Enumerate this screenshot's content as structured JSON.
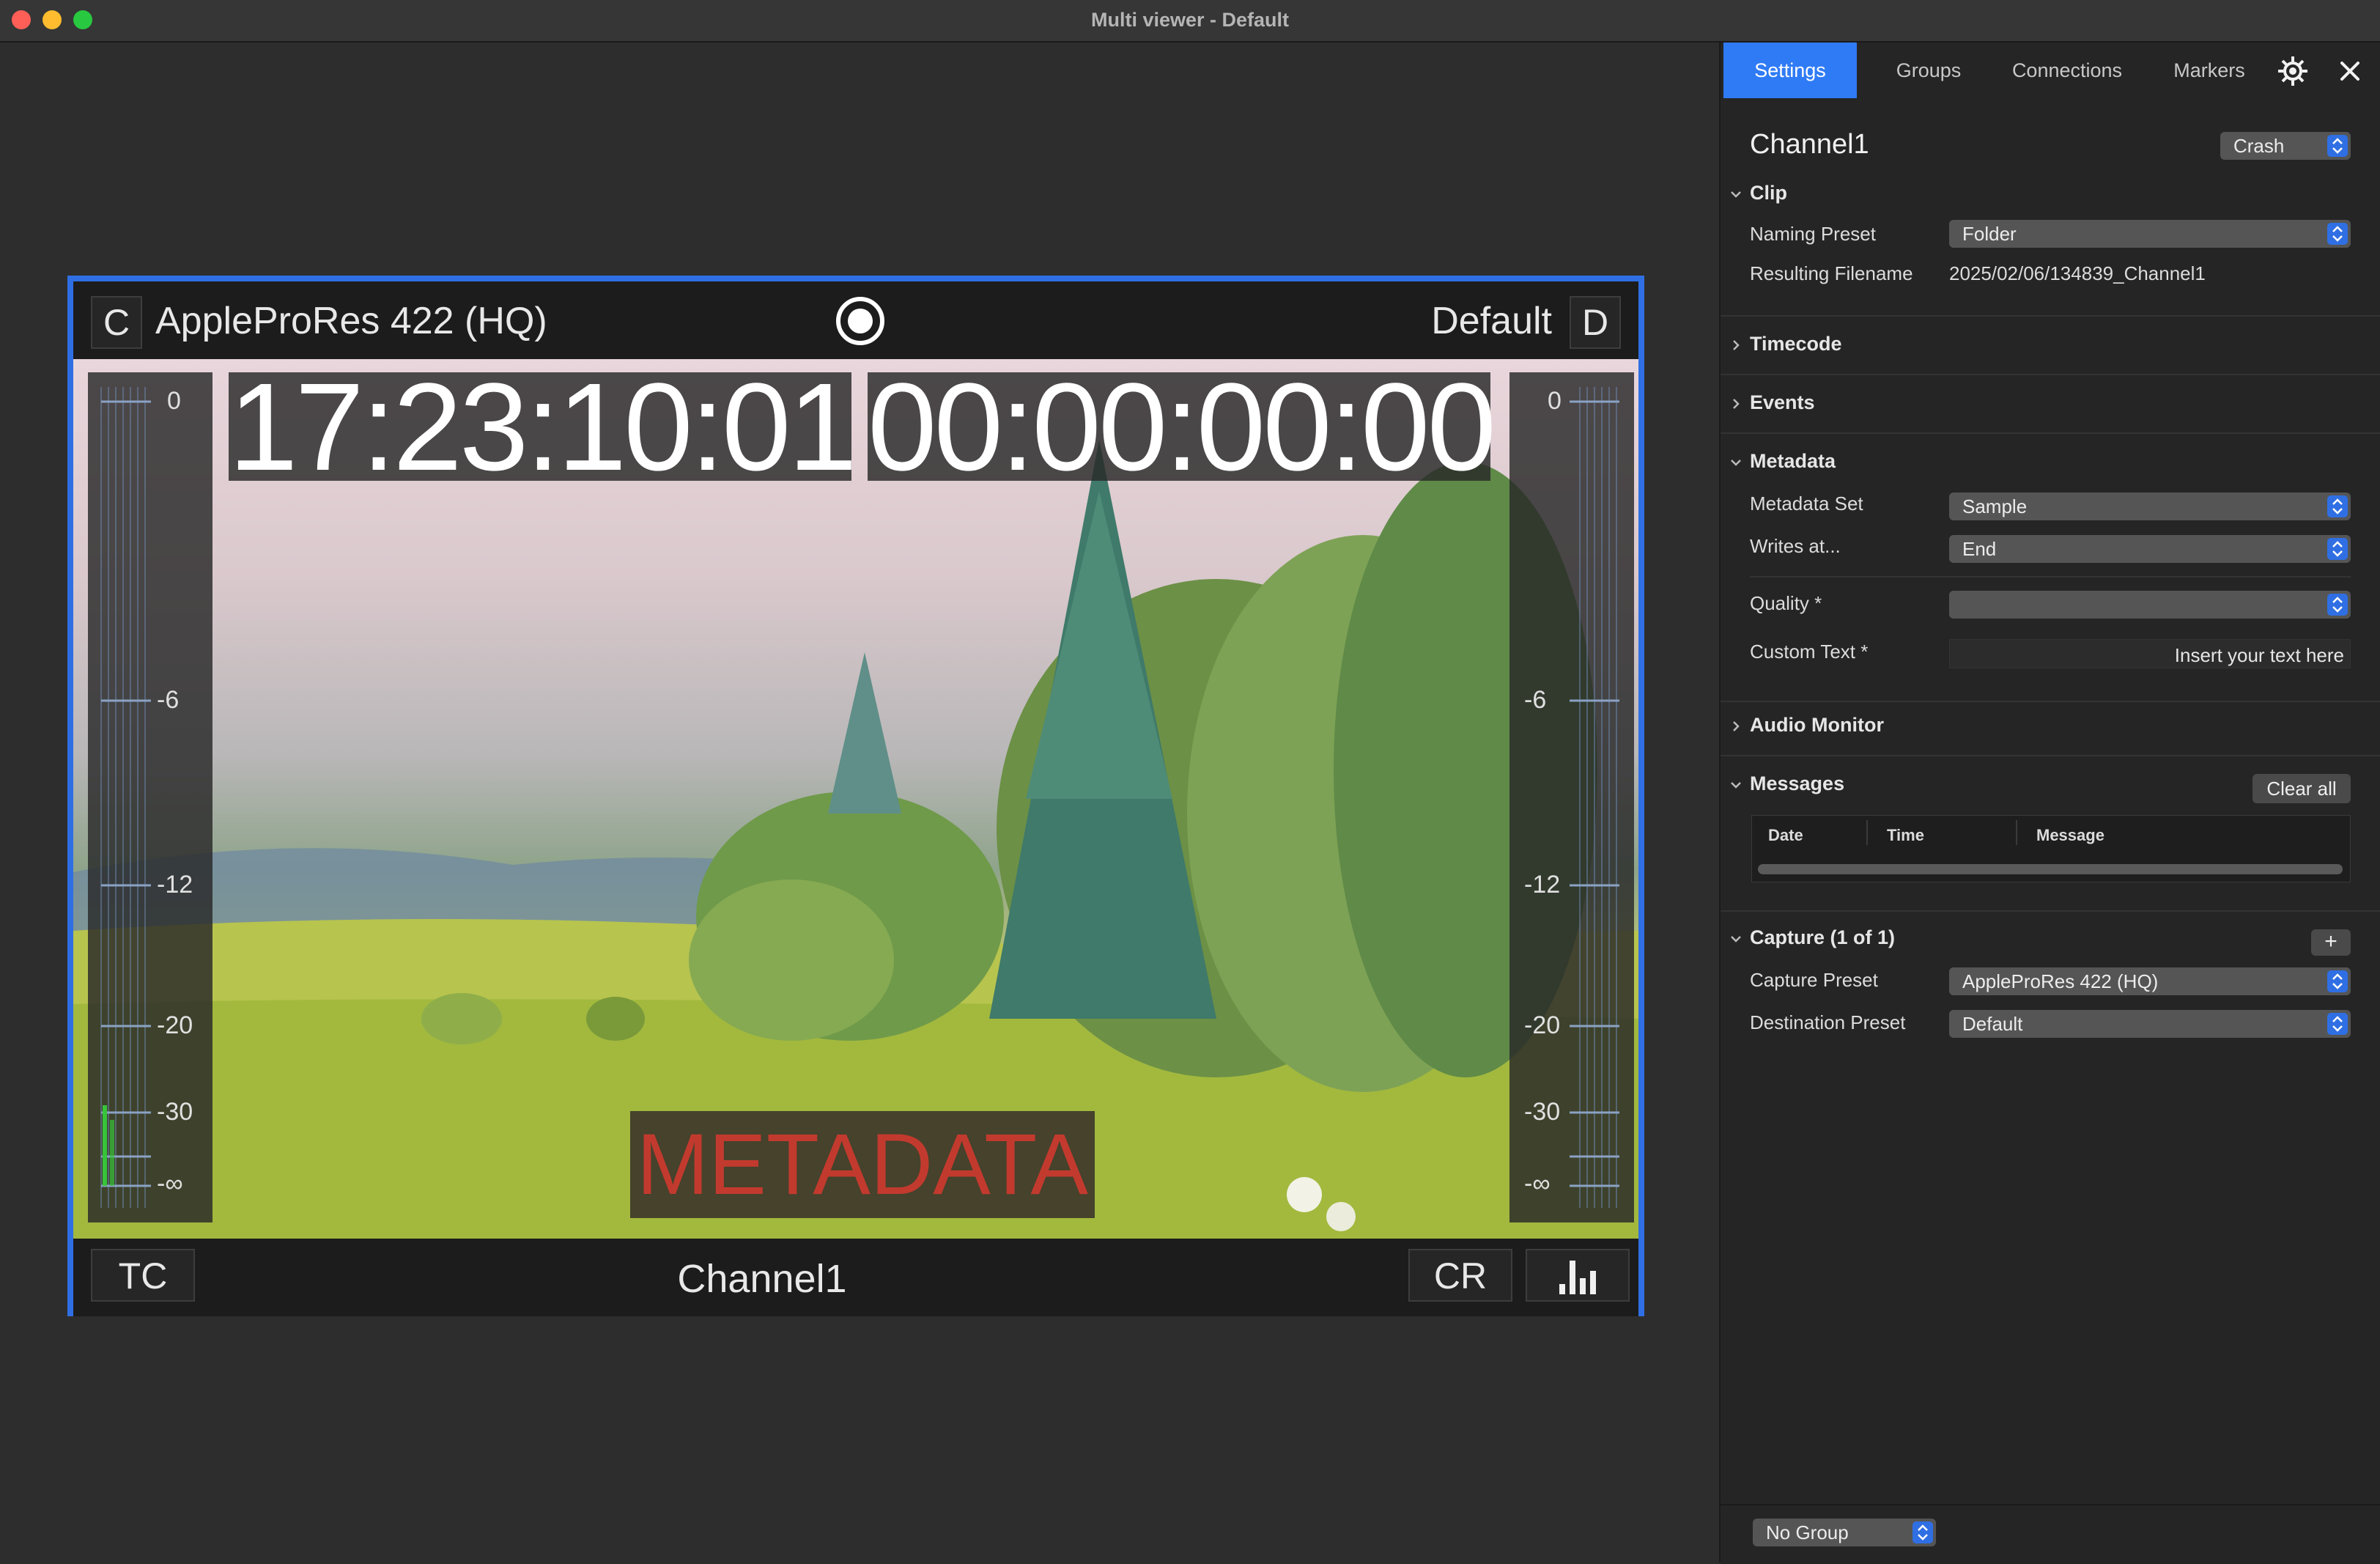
{
  "window": {
    "title": "Multi viewer - Default"
  },
  "monitor": {
    "codec_letter": "C",
    "codec_name": "AppleProRes 422 (HQ)",
    "destination_name": "Default",
    "destination_letter": "D",
    "timecode": "17:23:10:01",
    "duration": "00:00:00:00",
    "meter_left_ticks": [
      "0",
      "-6",
      "-12",
      "-20",
      "-30",
      "-∞"
    ],
    "meter_right_ticks": [
      "0",
      "-6",
      "-12",
      "-20",
      "-30",
      "-∞"
    ],
    "metadata_overlay": "METADATA",
    "tc_button": "TC",
    "channel_name": "Channel1",
    "cr_button": "CR"
  },
  "panel": {
    "tabs": {
      "settings": "Settings",
      "groups": "Groups",
      "connections": "Connections",
      "markers": "Markers"
    },
    "channel_title": "Channel1",
    "crash_select": "Crash",
    "clip": {
      "title": "Clip",
      "naming_preset_label": "Naming Preset",
      "naming_preset_value": "Folder",
      "resulting_filename_label": "Resulting Filename",
      "resulting_filename_value": "2025/02/06/134839_Channel1"
    },
    "timecode_title": "Timecode",
    "events_title": "Events",
    "metadata": {
      "title": "Metadata",
      "set_label": "Metadata Set",
      "set_value": "Sample",
      "writes_label": "Writes at...",
      "writes_value": "End",
      "quality_label": "Quality *",
      "quality_value": "",
      "custom_text_label": "Custom Text *",
      "custom_text_value": "Insert your text here"
    },
    "audio_monitor_title": "Audio Monitor",
    "messages": {
      "title": "Messages",
      "clear_all": "Clear all",
      "columns": [
        "Date",
        "Time",
        "Message"
      ]
    },
    "capture": {
      "title": "Capture (1 of 1)",
      "add_label": "+",
      "preset_label": "Capture Preset",
      "preset_value": "AppleProRes 422 (HQ)",
      "destination_label": "Destination Preset",
      "destination_value": "Default"
    },
    "group_select": "No Group"
  },
  "colors": {
    "accent": "#2f7bf5",
    "monitor_border": "#2f6fe3",
    "metadata_text": "#c23a2e",
    "audio_level": "#37c43a"
  },
  "audio_levels": {
    "left_channel_fraction": 0.08,
    "right_channel_fraction": 0.0
  }
}
